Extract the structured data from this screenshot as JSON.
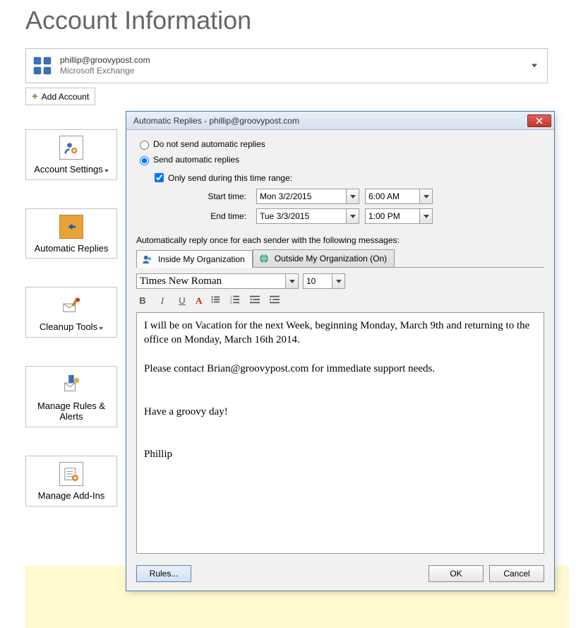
{
  "page": {
    "title": "Account Information"
  },
  "account": {
    "email": "phillip@groovypost.com",
    "type": "Microsoft Exchange"
  },
  "add_account_label": "Add Account",
  "sidebar": {
    "settings": "Account Settings",
    "autoreplies": "Automatic Replies",
    "cleanup": "Cleanup Tools",
    "rules": "Manage Rules & Alerts",
    "addins": "Manage Add-Ins"
  },
  "dialog": {
    "title": "Automatic Replies -  phillip@groovypost.com",
    "radio_off": "Do not send automatic replies",
    "radio_on": "Send automatic replies",
    "only_range": "Only send during this time range:",
    "start_label": "Start time:",
    "end_label": "End time:",
    "start_date": "Mon 3/2/2015",
    "start_time": "6:00 AM",
    "end_date": "Tue 3/3/2015",
    "end_time": "1:00 PM",
    "section_label": "Automatically reply once for each sender with the following messages:",
    "tab_inside": "Inside My Organization",
    "tab_outside": "Outside My Organization (On)",
    "font_name": "Times New Roman",
    "font_size": "10",
    "body": "I will be on Vacation for the next Week, beginning Monday, March 9th and returning to the office on Monday, March 16th 2014.\n\nPlease contact Brian@groovypost.com for immediate support needs.\n\n\nHave a groovy day!\n\n\nPhillip",
    "rules_btn": "Rules...",
    "ok_btn": "OK",
    "cancel_btn": "Cancel"
  }
}
